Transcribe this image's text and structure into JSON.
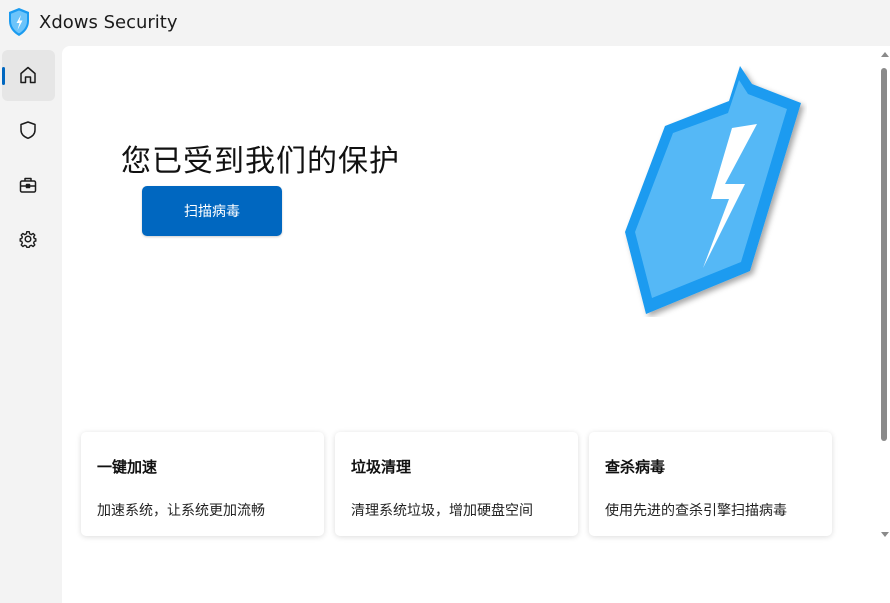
{
  "app": {
    "title": "Xdows Security",
    "icon": "shield-bolt-icon"
  },
  "sidebar": {
    "items": [
      {
        "name": "home",
        "icon": "home-icon",
        "active": true
      },
      {
        "name": "protection",
        "icon": "shield-icon",
        "active": false
      },
      {
        "name": "toolbox",
        "icon": "toolbox-icon",
        "active": false
      },
      {
        "name": "settings",
        "icon": "gear-icon",
        "active": false
      }
    ]
  },
  "main": {
    "status_title": "您已受到我们的保护",
    "scan_button_label": "扫描病毒",
    "hero_image": "shield-lightning-icon",
    "cards": [
      {
        "title": "一键加速",
        "description": "加速系统，让系统更加流畅"
      },
      {
        "title": "垃圾清理",
        "description": "清理系统垃圾，增加硬盘空间"
      },
      {
        "title": "查杀病毒",
        "description": "使用先进的查杀引擎扫描病毒"
      }
    ]
  },
  "colors": {
    "accent": "#0067c0",
    "shield_outer": "#1a9bf0",
    "shield_inner": "#55b8f6",
    "background": "#f3f3f3",
    "content_bg": "#ffffff"
  }
}
